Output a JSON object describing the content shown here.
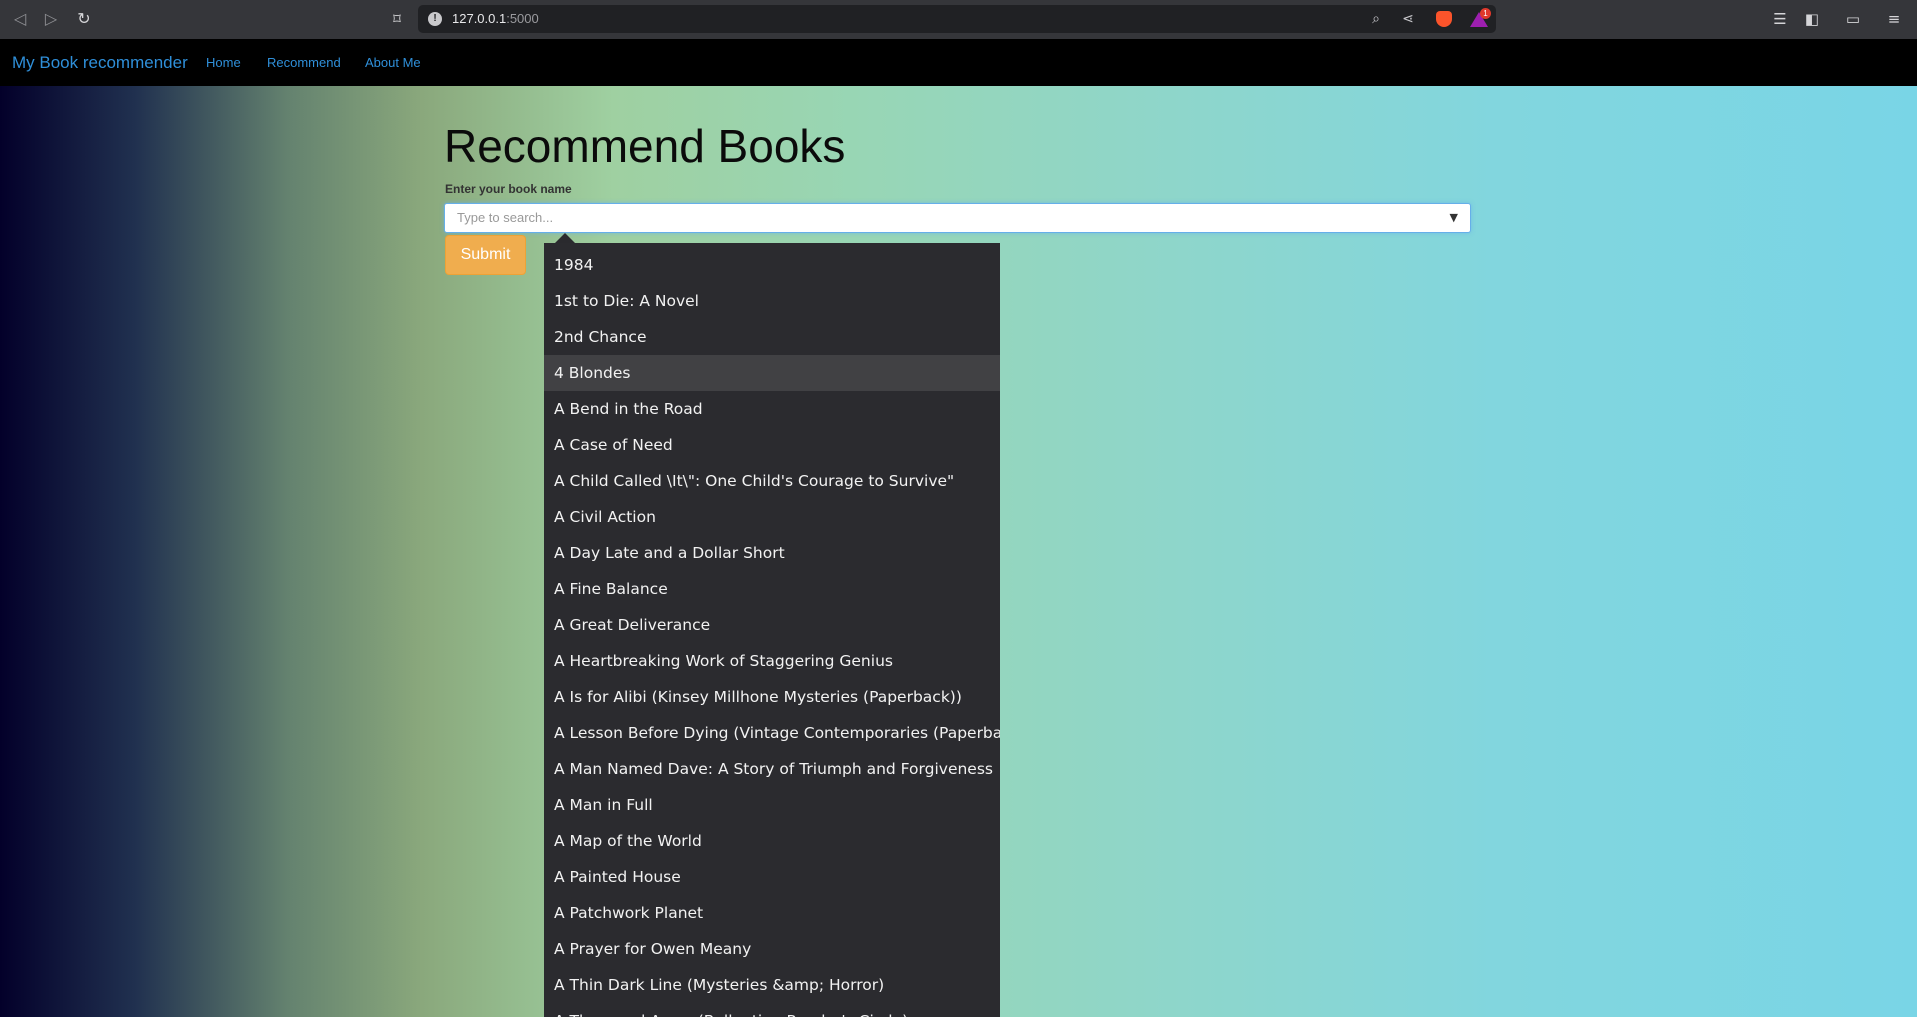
{
  "browser": {
    "url_host": "127.0.0.1",
    "url_port": ":5000",
    "rewards_badge": "1"
  },
  "nav": {
    "brand": "My Book recommender",
    "links": [
      "Home",
      "Recommend",
      "About Me"
    ]
  },
  "main": {
    "title": "Recommend Books",
    "field_label": "Enter your book name",
    "search_placeholder": "Type to search...",
    "submit_label": "Submit"
  },
  "dropdown": {
    "highlighted_index": 3,
    "options": [
      "1984",
      "1st to Die: A Novel",
      "2nd Chance",
      "4 Blondes",
      "A Bend in the Road",
      "A Case of Need",
      "A Child Called \\It\\\": One Child's Courage to Survive\"",
      "A Civil Action",
      "A Day Late and a Dollar Short",
      "A Fine Balance",
      "A Great Deliverance",
      "A Heartbreaking Work of Staggering Genius",
      "A Is for Alibi (Kinsey Millhone Mysteries (Paperback))",
      "A Lesson Before Dying (Vintage Contemporaries (Paperback))",
      "A Man Named Dave: A Story of Triumph and Forgiveness",
      "A Man in Full",
      "A Map of the World",
      "A Painted House",
      "A Patchwork Planet",
      "A Prayer for Owen Meany",
      "A Thin Dark Line (Mysteries &amp; Horror)",
      "A Thousand Acres (Ballantine Reader's Circle)"
    ]
  }
}
